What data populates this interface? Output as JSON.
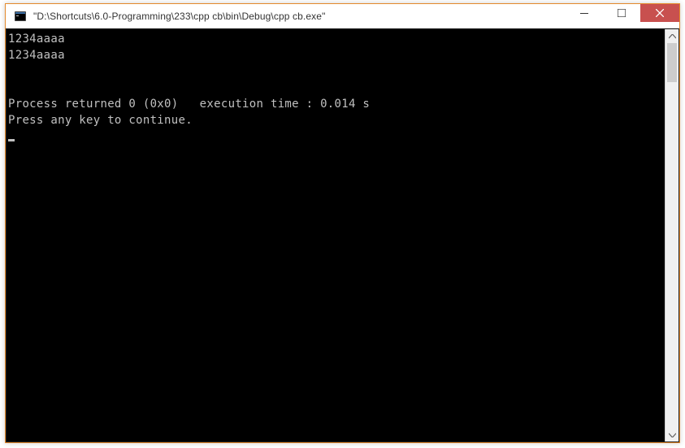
{
  "window": {
    "title": "\"D:\\Shortcuts\\6.0-Programming\\233\\cpp cb\\bin\\Debug\\cpp cb.exe\"",
    "icon_name": "terminal-icon"
  },
  "titlebar_buttons": {
    "minimize_label": "Minimize",
    "maximize_label": "Maximize",
    "close_label": "Close"
  },
  "console": {
    "lines": [
      "1234aaaa",
      "1234aaaa",
      "",
      "",
      "Process returned 0 (0x0)   execution time : 0.014 s",
      "Press any key to continue."
    ],
    "return_code": 0,
    "return_code_hex": "0x0",
    "execution_time_s": 0.014
  },
  "colors": {
    "window_border": "#e58a2c",
    "close_button": "#c8504f",
    "console_bg": "#000000",
    "console_fg": "#c0c0c0",
    "scrollbar_thumb": "#cdcdcd"
  }
}
